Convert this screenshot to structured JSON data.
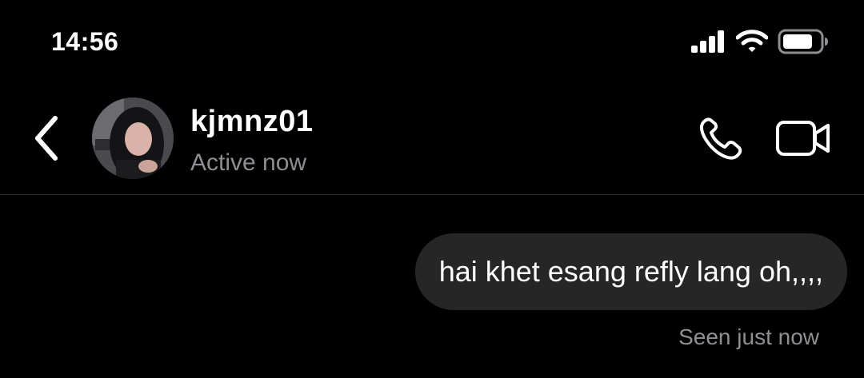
{
  "status_bar": {
    "time": "14:56",
    "icons": [
      "cellular-signal-icon",
      "wifi-icon",
      "battery-icon"
    ]
  },
  "header": {
    "back_icon": "chevron-left-icon",
    "username": "kjmnz01",
    "presence": "Active now",
    "call_icon": "phone-icon",
    "video_icon": "video-camera-icon"
  },
  "messages": [
    {
      "direction": "outgoing",
      "text": "hai khet esang refly lang oh,,,,"
    }
  ],
  "receipt": "Seen just now",
  "colors": {
    "background": "#000000",
    "bubble": "#262626",
    "secondary_text": "#8e8e93",
    "divider": "#2b2b2b"
  }
}
